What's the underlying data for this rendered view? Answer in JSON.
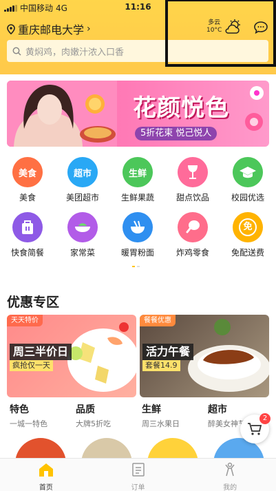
{
  "status_bar": {
    "carrier": "中国移动",
    "network": "4G",
    "time": "11:16"
  },
  "location": {
    "name": "重庆邮电大学",
    "chevron": "›"
  },
  "weather": {
    "condition": "多云",
    "temperature": "10°C"
  },
  "search": {
    "placeholder": "黄焖鸡，肉嫩汁浓入口香"
  },
  "banner": {
    "title": "花颜悦色",
    "subtitle": "5折花束 悦己悦人"
  },
  "categories": [
    {
      "label": "美食",
      "icon_text": "美食",
      "color": "#ff7043"
    },
    {
      "label": "美团超市",
      "icon_text": "超市",
      "color": "#29a8f5"
    },
    {
      "label": "生鲜果蔬",
      "icon_text": "生鲜",
      "color": "#4cc75a"
    },
    {
      "label": "甜点饮品",
      "icon_text": "",
      "color": "#ff6b9a"
    },
    {
      "label": "校园优选",
      "icon_text": "",
      "color": "#4cc75a"
    },
    {
      "label": "快食简餐",
      "icon_text": "",
      "color": "#8e5ae6"
    },
    {
      "label": "家常菜",
      "icon_text": "",
      "color": "#b25ce8"
    },
    {
      "label": "暖胃粉面",
      "icon_text": "",
      "color": "#2f8ff0"
    },
    {
      "label": "炸鸡零食",
      "icon_text": "",
      "color": "#ff6d8b"
    },
    {
      "label": "免配送费",
      "icon_text": "免",
      "color": "#ffb300"
    }
  ],
  "promo": {
    "title": "优惠专区",
    "deals": [
      {
        "tag": "天天特价",
        "main": "周三半价日",
        "sub": "疯抢仅一天"
      },
      {
        "tag": "餐餐优惠",
        "main": "活力午餐",
        "sub": "套餐14.9"
      }
    ],
    "mini": [
      {
        "title": "特色",
        "sub": "一城一特色"
      },
      {
        "title": "品质",
        "sub": "大牌5折吃"
      },
      {
        "title": "生鲜",
        "sub": "周三水果日"
      },
      {
        "title": "超市",
        "sub": "醉美女神节"
      }
    ]
  },
  "cart": {
    "badge": "2"
  },
  "tabs": [
    {
      "label": "首页"
    },
    {
      "label": "订单"
    },
    {
      "label": "我的"
    }
  ]
}
